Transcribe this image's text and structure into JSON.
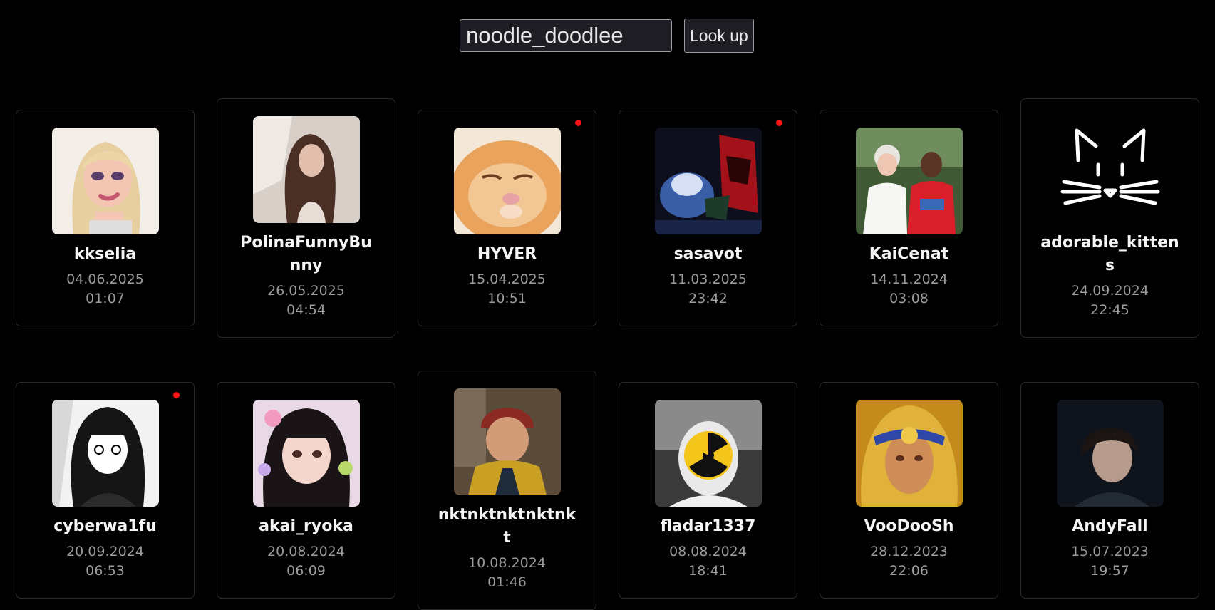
{
  "search": {
    "value": "noodle_doodlee",
    "button_label": "Look up"
  },
  "colors": {
    "background": "#000000",
    "live_indicator": "#ff1414",
    "muted_text": "#9b9b9b"
  },
  "profiles": [
    {
      "username": "kkselia",
      "date": "04.06.2025",
      "time": "01:07",
      "live": false,
      "avatar": "doll-avatar"
    },
    {
      "username": "PolinaFunnyBunny",
      "date": "26.05.2025",
      "time": "04:54",
      "live": false,
      "avatar": "portrait-avatar"
    },
    {
      "username": "HYVER",
      "date": "15.04.2025",
      "time": "10:51",
      "live": true,
      "avatar": "cat-avatar"
    },
    {
      "username": "sasavot",
      "date": "11.03.2025",
      "time": "23:42",
      "live": true,
      "avatar": "demon-avatar"
    },
    {
      "username": "KaiCenat",
      "date": "14.11.2024",
      "time": "03:08",
      "live": false,
      "avatar": "photo-avatar"
    },
    {
      "username": "adorable_kittens",
      "date": "24.09.2024",
      "time": "22:45",
      "live": false,
      "avatar": "cat-outline-avatar"
    },
    {
      "username": "cyberwa1fu",
      "date": "20.09.2024",
      "time": "06:53",
      "live": true,
      "avatar": "manga-avatar"
    },
    {
      "username": "akai_ryoka",
      "date": "20.08.2024",
      "time": "06:09",
      "live": false,
      "avatar": "anime-girl-avatar"
    },
    {
      "username": "nktnktnktnktnkt",
      "date": "10.08.2024",
      "time": "01:46",
      "live": false,
      "avatar": "game-character-avatar"
    },
    {
      "username": "fladar1337",
      "date": "08.08.2024",
      "time": "18:41",
      "live": false,
      "avatar": "radiation-avatar"
    },
    {
      "username": "VooDooSh",
      "date": "28.12.2023",
      "time": "22:06",
      "live": false,
      "avatar": "warrior-avatar"
    },
    {
      "username": "AndyFall",
      "date": "15.07.2023",
      "time": "19:57",
      "live": false,
      "avatar": "streamer-avatar"
    }
  ]
}
